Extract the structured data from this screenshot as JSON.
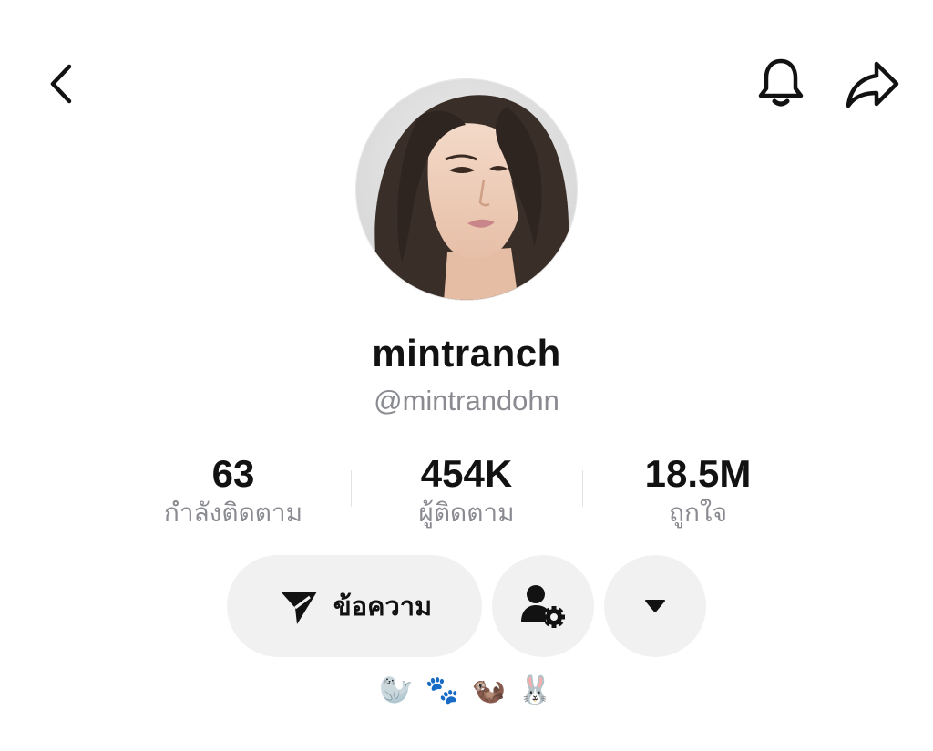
{
  "header": {
    "back_icon": "chevron-left-icon",
    "bell_icon": "bell-icon",
    "share_icon": "share-arrow-icon"
  },
  "profile": {
    "display_name": "mintranch",
    "handle": "@mintrandohn",
    "avatar": "profile-photo"
  },
  "stats": {
    "following": {
      "value": "63",
      "label": "กำลังติดตาม"
    },
    "followers": {
      "value": "454K",
      "label": "ผู้ติดตาม"
    },
    "likes": {
      "value": "18.5M",
      "label": "ถูกใจ"
    }
  },
  "actions": {
    "message_label": "ข้อความ",
    "message_icon": "send-arrow-icon",
    "follow_icon": "user-settings-icon",
    "more_icon": "caret-down-icon"
  },
  "bio": {
    "text": "🦭 🐾 🦦 🐰"
  }
}
